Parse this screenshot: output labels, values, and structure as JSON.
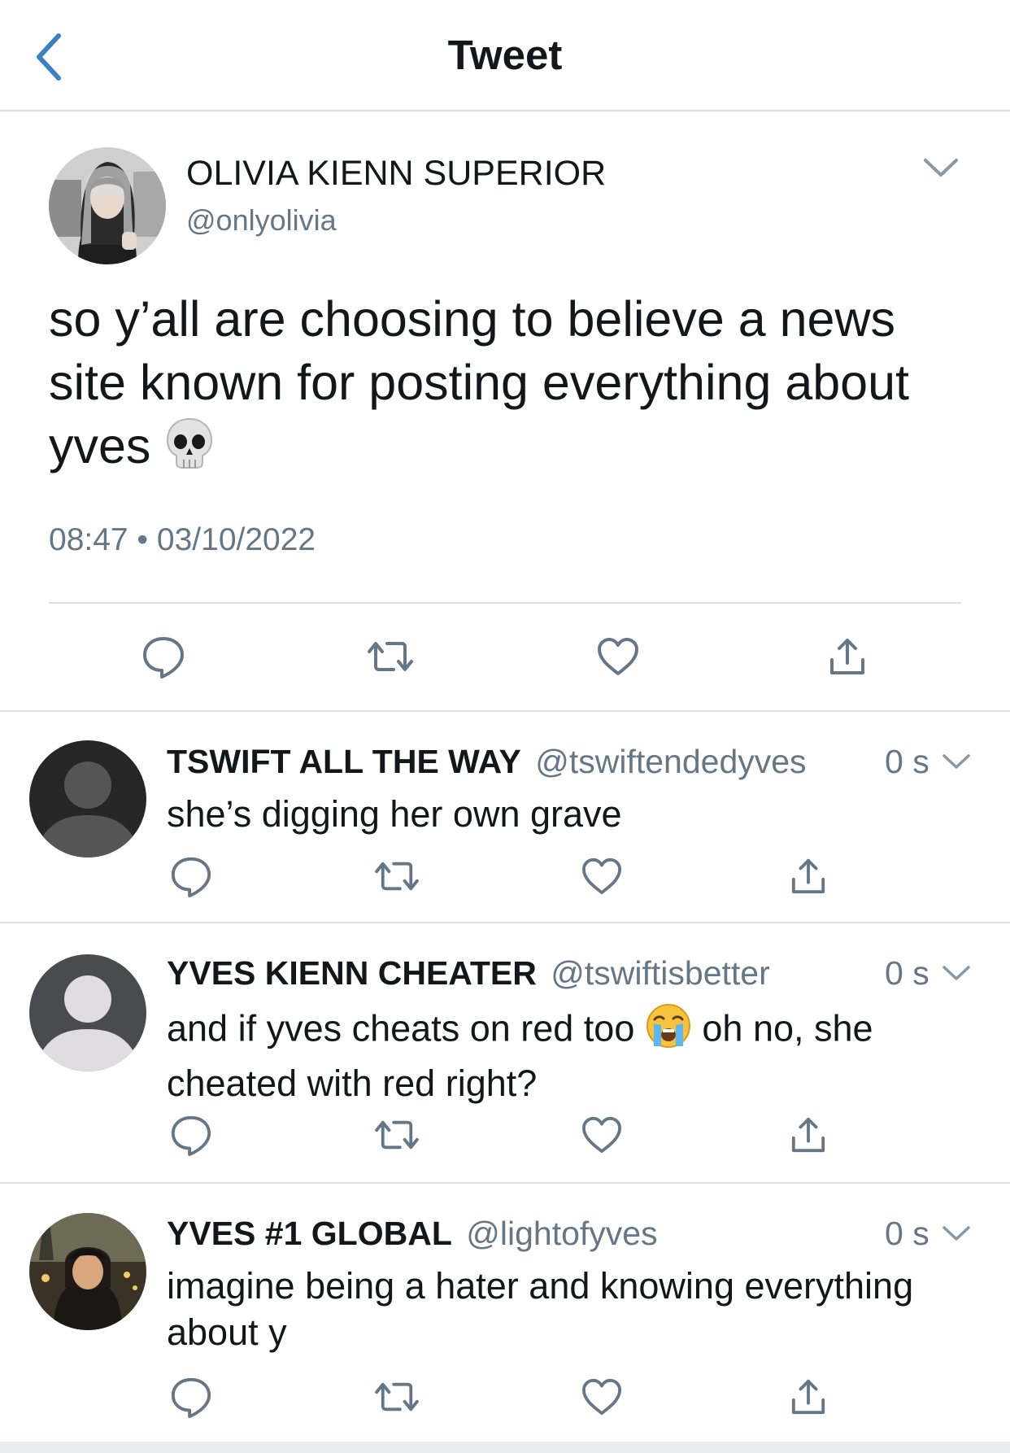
{
  "header": {
    "title": "Tweet"
  },
  "main_tweet": {
    "name": "OLIVIA KIENN SUPERIOR",
    "handle": "@onlyolivia",
    "text": "so y’all are choosing to believe a news site known for posting everything about yves",
    "emoji": "skull",
    "timestamp": "08:47 • 03/10/2022"
  },
  "replies": [
    {
      "name": "TSWIFT ALL THE WAY",
      "handle": "@tswiftendedyves",
      "time": "0 s",
      "text": "she’s digging her own grave",
      "avatar": "default-avatar-dark"
    },
    {
      "name": "YVES KIENN CHEATER",
      "handle": "@tswiftisbetter",
      "time": "0 s",
      "text_before": "and if yves cheats on red too",
      "emoji": "loudly-crying-face",
      "text_after": "oh no, she cheated with red right?",
      "avatar": "default-avatar-gray"
    },
    {
      "name": "YVES #1 GLOBAL",
      "handle": "@lightofyves",
      "time": "0 s",
      "text": "imagine being a hater and knowing everything about y",
      "avatar": "photo-avatar"
    }
  ],
  "icons": {
    "back": "chevron-left-icon",
    "more": "chevron-down-icon",
    "reply": "reply-icon",
    "retweet": "retweet-icon",
    "like": "heart-icon",
    "share": "share-icon"
  },
  "colors": {
    "accent": "#1da1f2",
    "back_arrow": "#3b82c4",
    "icon_gray": "#657786",
    "divider": "#dcdfe2",
    "text": "#14171a"
  }
}
